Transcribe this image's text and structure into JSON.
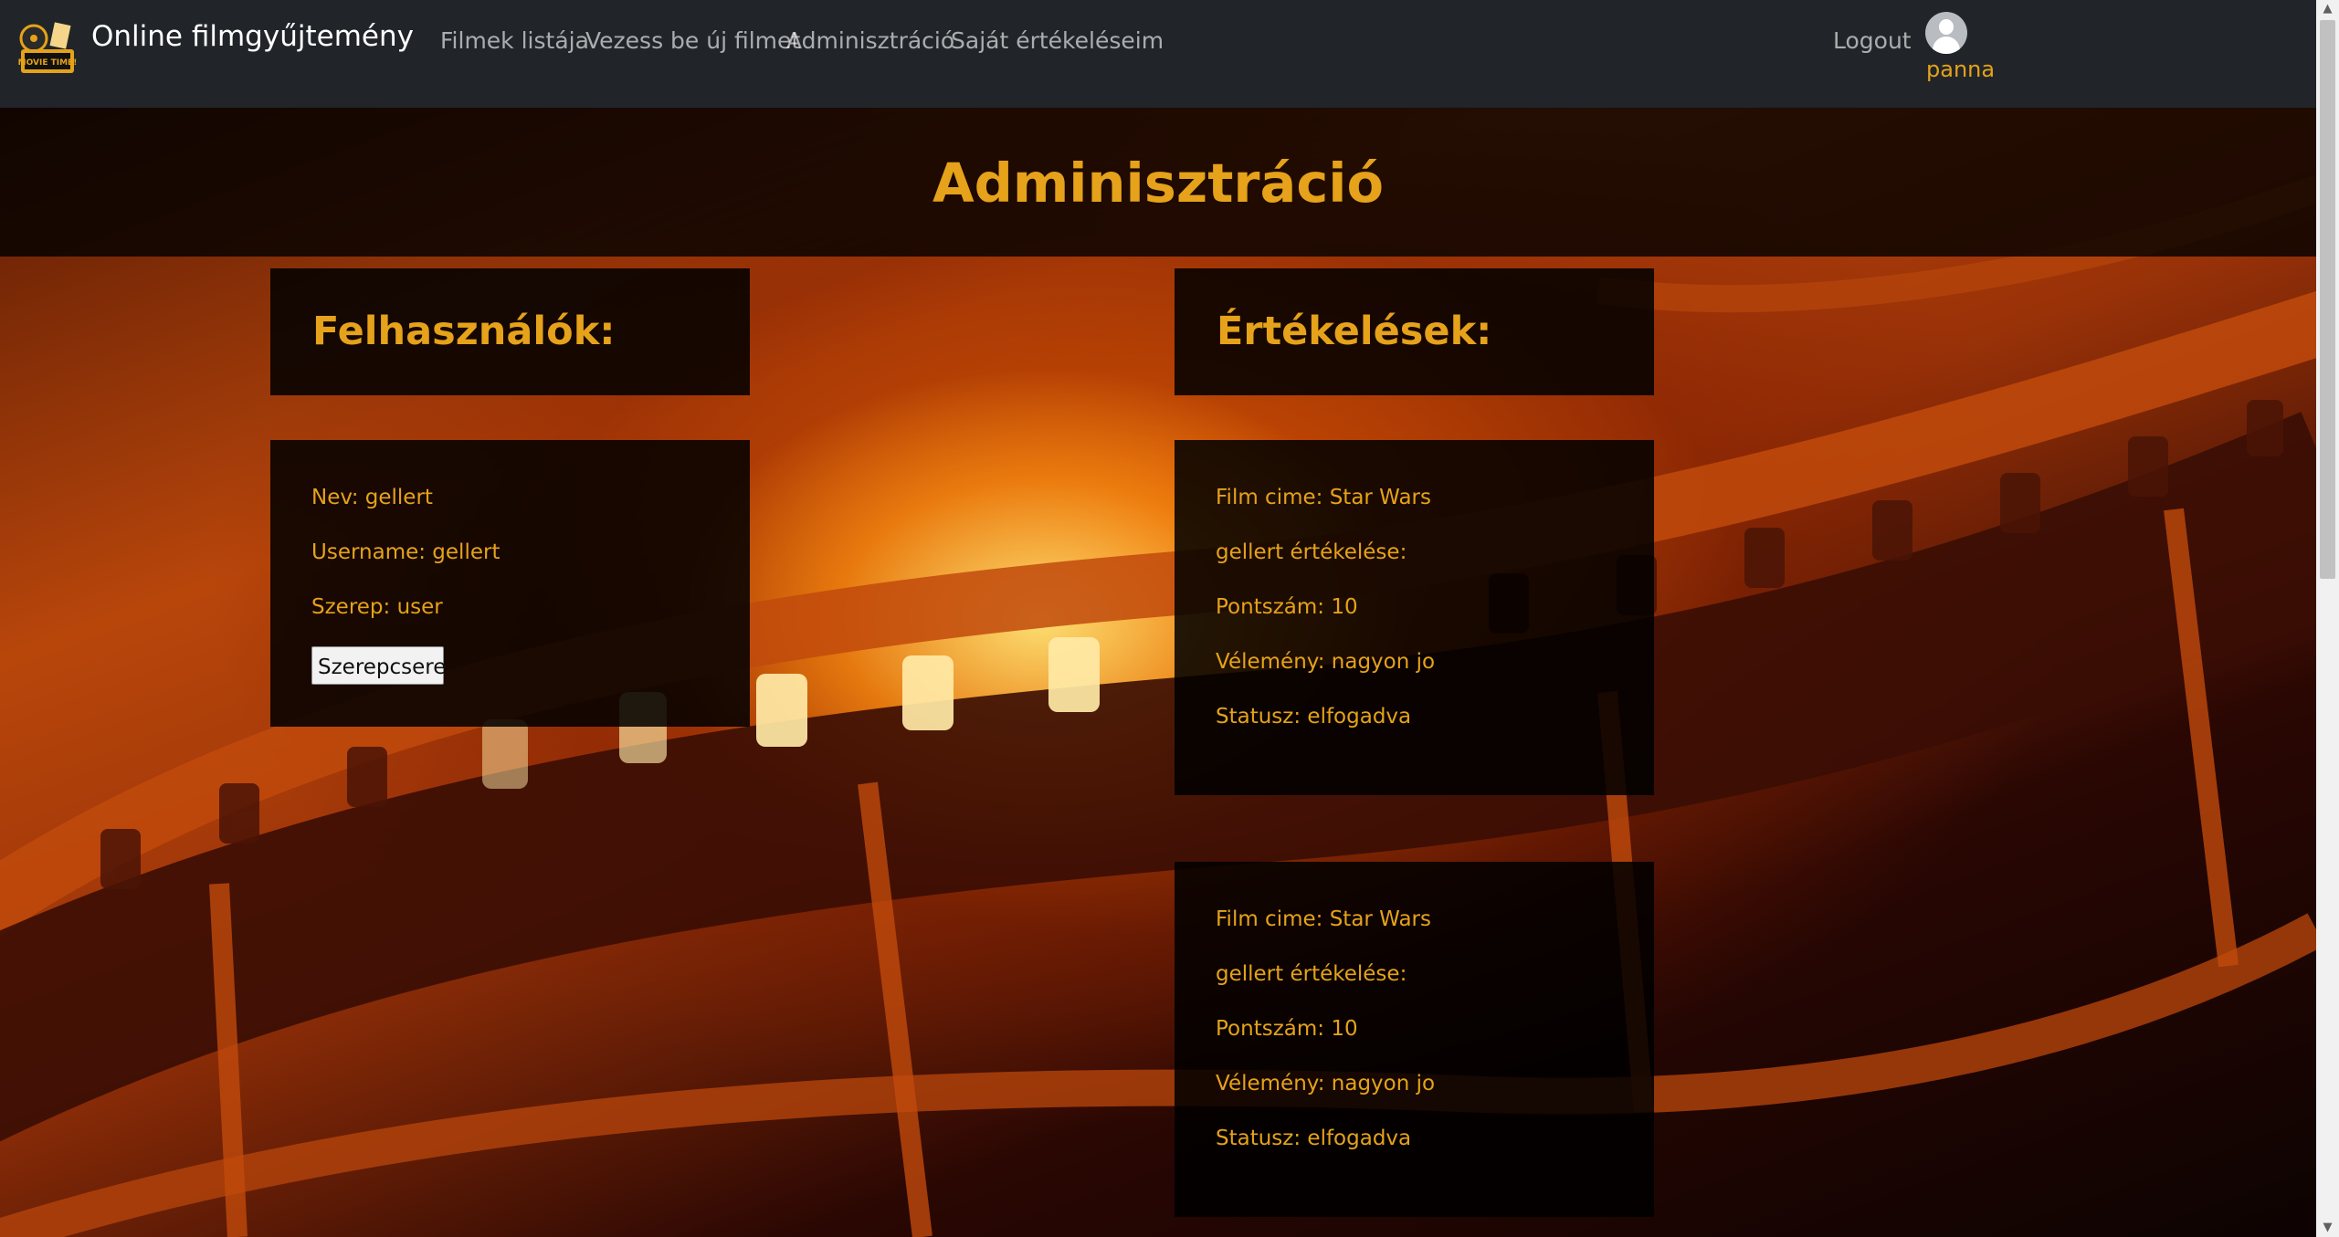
{
  "navbar": {
    "brand": "Online filmgyűjtemény",
    "logo_icon": "movie-time-logo",
    "links": [
      "Filmek listája",
      "Vezess be új filmet",
      "Adminisztráció",
      "Saját értékeléseim"
    ],
    "logout": "Logout",
    "username": "panna",
    "avatar_icon": "user-avatar-icon"
  },
  "header": {
    "title": "Adminisztráció"
  },
  "users_section": {
    "title": "Felhasználók:",
    "users": [
      {
        "name": "Nev: gellert",
        "username": "Username: gellert",
        "role": "Szerep: user",
        "button": "Szerepcsere"
      }
    ]
  },
  "reviews_section": {
    "title": "Értékelések:",
    "reviews": [
      {
        "film": "Film cime: Star Wars",
        "reviewer": "gellert értékelése:",
        "score": "Pontszám: 10",
        "opinion": "Vélemény: nagyon jo",
        "status": "Statusz: elfogadva"
      },
      {
        "film": "Film cime: Star Wars",
        "reviewer": "gellert értékelése:",
        "score": "Pontszám: 10",
        "opinion": "Vélemény: nagyon jo",
        "status": "Statusz: elfogadva"
      }
    ]
  },
  "colors": {
    "accent": "#e5a21a",
    "navbar": "#212529"
  }
}
